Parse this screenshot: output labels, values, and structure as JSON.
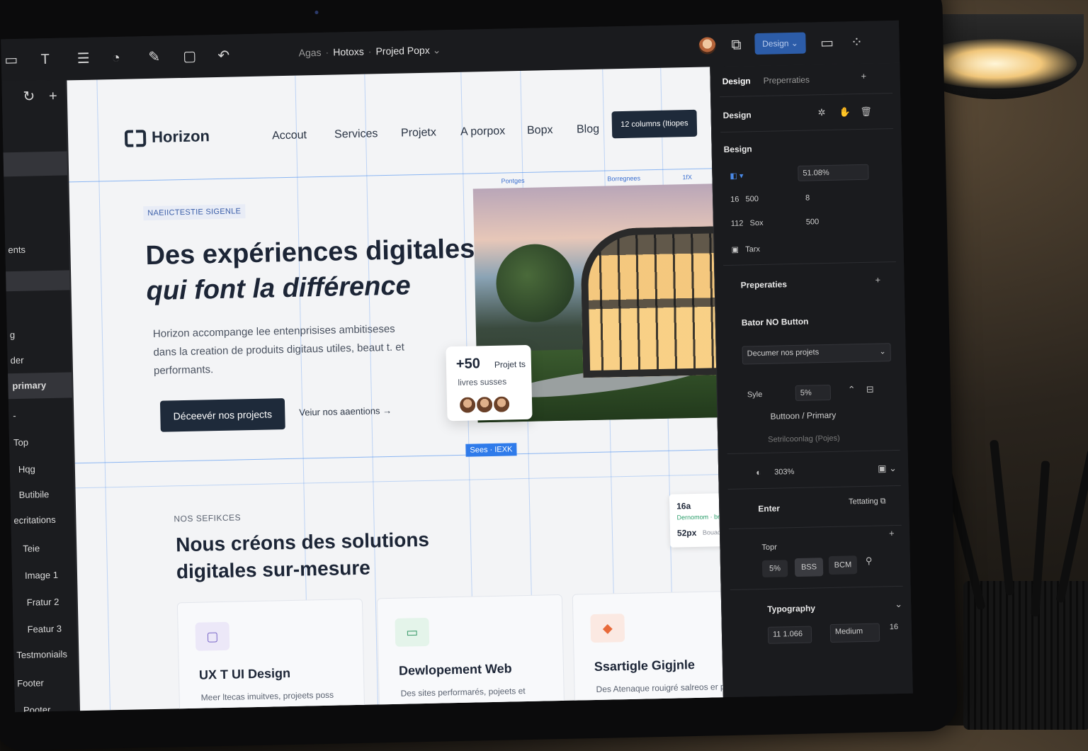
{
  "toolbar": {
    "breadcrumb": [
      "Agas",
      "Hotoxs",
      "Projed Popx"
    ],
    "design_button": "Design"
  },
  "layers": {
    "items": [
      "ents",
      "g",
      "der",
      "primary",
      "-",
      "Top",
      "Hqg",
      "Butibile",
      "ecritations",
      "Teie",
      "Image 1",
      "Fratur 2",
      "Featur 3",
      "Testmoniails",
      "Footer",
      "Pooter"
    ]
  },
  "site": {
    "logo": "Horizon",
    "nav": [
      "Accout",
      "Services",
      "Projetx",
      "A porpox",
      "Bopx",
      "Blog"
    ],
    "top_cta": "12 columns (Itiopes",
    "guide_labels": [
      "Pontges",
      "Borregnees",
      "1fX"
    ],
    "tag": "NAEIICTESTIE SIGENLE",
    "hero_title_line1": "Des expériences digitales",
    "hero_title_line2": "qui font la différence",
    "hero_lead": "Horizon accompange lee entenprisises ambitiseses dans la creation de produits digitaus utiles, beaut t. et performants.",
    "primary_button": "Déceevér nos projects",
    "secondary_link": "Veiur nos aaentions →",
    "stat_big": "+50",
    "stat_small": "Projet ts",
    "stat_sub": "livres susses",
    "selection_chip": "Sees · IEXK",
    "services_eyebrow": "NOS SEFIKCES",
    "services_title": "Nous créons des solutions digitales sur-mesure",
    "spacing": {
      "top_value": "16a",
      "top_note": "Dernomom · bres",
      "bottom_value": "52px",
      "bottom_note": "Bouacinnes"
    },
    "cards": [
      {
        "title": "UX T UI Design",
        "desc": "Meer ltecas imuitves, projeets poss ros ullitisatrurs."
      },
      {
        "title": "Dewlopement Web",
        "desc": "Des sites performarés, pojeets et adgités à nos ohgencéfs."
      },
      {
        "title": "Ssartigle Gigjnle",
        "desc": "Des Atenaque rouigré salreos er pedt fochnres."
      }
    ]
  },
  "props": {
    "tabs": [
      "Design",
      "Preperraties"
    ],
    "section_design": "Design",
    "section_besign": "Besign",
    "opacity": "51.08%",
    "rows": [
      {
        "label": "16",
        "value": "500",
        "label2": "8"
      },
      {
        "label": "112",
        "value": "Sox",
        "label2": "500"
      },
      {
        "label": "",
        "value": "Tarx",
        "label2": ""
      }
    ],
    "properties_title": "Preperaties",
    "component_name": "Bator NO Button",
    "variant_select": "Decumer nos projets",
    "style_label": "Syle",
    "style_value": "5%",
    "breadcrumb_variant": [
      "Buttoon",
      "Primary"
    ],
    "settings_label": "Setrilcoonlag (Pojes)",
    "zoom": "303%",
    "enter_label": "Enter",
    "textarting_label": "Tettating",
    "topr_label": "Topr",
    "pill_values": [
      "5%",
      "BSS",
      "BCM"
    ],
    "typography_label": "Typography",
    "font_value": "11 1.066",
    "weight_value": "Medium",
    "size_value": "16"
  }
}
